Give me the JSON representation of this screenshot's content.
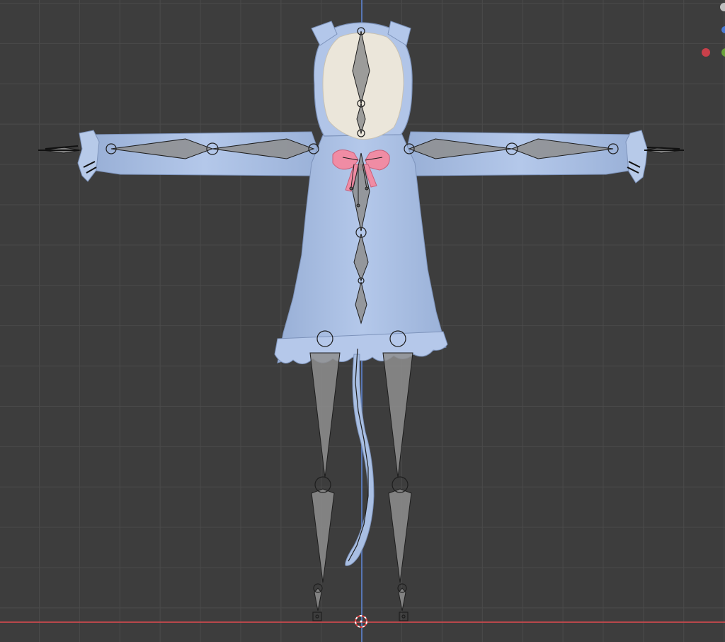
{
  "viewport": {
    "background_color": "#3d3d3d",
    "grid_color": "#4a4a4a",
    "axis_x_color": "#c5484d",
    "axis_z_color": "#5b7fc7"
  },
  "model": {
    "outfit_color": "#a9c0e4",
    "hood_inner_color": "#ece8de",
    "bow_color": "#f08ca4"
  },
  "armature": {
    "bone_color": "#8e8e8e",
    "bone_outline_color": "#1e1e1e"
  },
  "gizmo": {
    "icons": [
      "gizmo-x-axis-icon",
      "gizmo-y-axis-icon",
      "gizmo-z-axis-icon",
      "gizmo-view-icon"
    ]
  }
}
